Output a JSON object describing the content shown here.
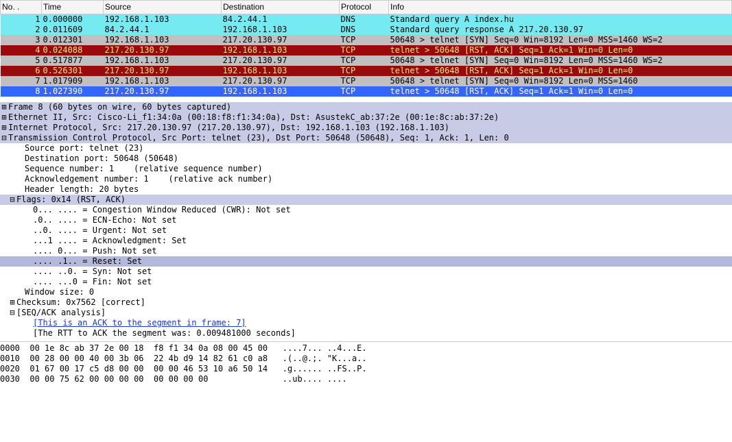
{
  "columns": {
    "no": "No. .",
    "time": "Time",
    "src": "Source",
    "dst": "Destination",
    "proto": "Protocol",
    "info": "Info"
  },
  "packets": [
    {
      "no": "1",
      "time": "0.000000",
      "src": "192.168.1.103",
      "dst": "84.2.44.1",
      "proto": "DNS",
      "info": "Standard query A index.hu",
      "cls": "row-cyan"
    },
    {
      "no": "2",
      "time": "0.011609",
      "src": "84.2.44.1",
      "dst": "192.168.1.103",
      "proto": "DNS",
      "info": "Standard query response A 217.20.130.97",
      "cls": "row-cyan"
    },
    {
      "no": "3",
      "time": "0.012301",
      "src": "192.168.1.103",
      "dst": "217.20.130.97",
      "proto": "TCP",
      "info": "50648 > telnet [SYN] Seq=0 Win=8192 Len=0 MSS=1460 WS=2",
      "cls": "row-grey"
    },
    {
      "no": "4",
      "time": "0.024088",
      "src": "217.20.130.97",
      "dst": "192.168.1.103",
      "proto": "TCP",
      "info": "telnet > 50648 [RST, ACK] Seq=1 Ack=1 Win=0 Len=0",
      "cls": "row-red"
    },
    {
      "no": "5",
      "time": "0.517877",
      "src": "192.168.1.103",
      "dst": "217.20.130.97",
      "proto": "TCP",
      "info": "50648 > telnet [SYN] Seq=0 Win=8192 Len=0 MSS=1460 WS=2",
      "cls": "row-grey"
    },
    {
      "no": "6",
      "time": "0.526301",
      "src": "217.20.130.97",
      "dst": "192.168.1.103",
      "proto": "TCP",
      "info": "telnet > 50648 [RST, ACK] Seq=1 Ack=1 Win=0 Len=0",
      "cls": "row-red"
    },
    {
      "no": "7",
      "time": "1.017909",
      "src": "192.168.1.103",
      "dst": "217.20.130.97",
      "proto": "TCP",
      "info": "50648 > telnet [SYN] Seq=0 Win=8192 Len=0 MSS=1460",
      "cls": "row-grey"
    },
    {
      "no": "8",
      "time": "1.027390",
      "src": "217.20.130.97",
      "dst": "192.168.1.103",
      "proto": "TCP",
      "info": "telnet > 50648 [RST, ACK] Seq=1 Ack=1 Win=0 Len=0",
      "cls": "row-blue"
    }
  ],
  "details": [
    {
      "ind": "⊞",
      "text": "Frame 8 (60 bytes on wire, 60 bytes captured)",
      "lvl": 0,
      "cls": "hi"
    },
    {
      "ind": "⊞",
      "text": "Ethernet II, Src: Cisco-Li_f1:34:0a (00:18:f8:f1:34:0a), Dst: AsustekC_ab:37:2e (00:1e:8c:ab:37:2e)",
      "lvl": 0,
      "cls": "hi"
    },
    {
      "ind": "⊞",
      "text": "Internet Protocol, Src: 217.20.130.97 (217.20.130.97), Dst: 192.168.1.103 (192.168.1.103)",
      "lvl": 0,
      "cls": "hi"
    },
    {
      "ind": "⊟",
      "text": "Transmission Control Protocol, Src Port: telnet (23), Dst Port: 50648 (50648), Seq: 1, Ack: 1, Len: 0",
      "lvl": 0,
      "cls": "hi"
    },
    {
      "ind": "",
      "text": "Source port: telnet (23)",
      "lvl": 2
    },
    {
      "ind": "",
      "text": "Destination port: 50648 (50648)",
      "lvl": 2
    },
    {
      "ind": "",
      "text": "Sequence number: 1    (relative sequence number)",
      "lvl": 2
    },
    {
      "ind": "",
      "text": "Acknowledgement number: 1    (relative ack number)",
      "lvl": 2
    },
    {
      "ind": "",
      "text": "Header length: 20 bytes",
      "lvl": 2
    },
    {
      "ind": "⊟",
      "text": "Flags: 0x14 (RST, ACK)",
      "lvl": 1,
      "cls": "hi"
    },
    {
      "ind": "",
      "text": "0... .... = Congestion Window Reduced (CWR): Not set",
      "lvl": 3
    },
    {
      "ind": "",
      "text": ".0.. .... = ECN-Echo: Not set",
      "lvl": 3
    },
    {
      "ind": "",
      "text": "..0. .... = Urgent: Not set",
      "lvl": 3
    },
    {
      "ind": "",
      "text": "...1 .... = Acknowledgment: Set",
      "lvl": 3
    },
    {
      "ind": "",
      "text": ".... 0... = Push: Not set",
      "lvl": 3
    },
    {
      "ind": "",
      "text": ".... .1.. = Reset: Set",
      "lvl": 3,
      "cls": "sel"
    },
    {
      "ind": "",
      "text": ".... ..0. = Syn: Not set",
      "lvl": 3
    },
    {
      "ind": "",
      "text": ".... ...0 = Fin: Not set",
      "lvl": 3
    },
    {
      "ind": "",
      "text": "Window size: 0",
      "lvl": 2
    },
    {
      "ind": "⊞",
      "text": "Checksum: 0x7562 [correct]",
      "lvl": 1
    },
    {
      "ind": "⊟",
      "text": "[SEQ/ACK analysis]",
      "lvl": 1
    },
    {
      "ind": "",
      "text": "[This is an ACK to the segment in frame: 7]",
      "lvl": 3,
      "link": true
    },
    {
      "ind": "",
      "text": "[The RTT to ACK the segment was: 0.009481000 seconds]",
      "lvl": 3
    }
  ],
  "hex": [
    "0000  00 1e 8c ab 37 2e 00 18  f8 f1 34 0a 08 00 45 00   ....7... ..4...E.",
    "0010  00 28 00 00 40 00 3b 06  22 4b d9 14 82 61 c0 a8   .(..@.;. \"K...a..",
    "0020  01 67 00 17 c5 d8 00 00  00 00 46 53 10 a6 50 14   .g...... ..FS..P.",
    "0030  00 00 75 62 00 00 00 00  00 00 00 00               ..ub.... ...."
  ]
}
